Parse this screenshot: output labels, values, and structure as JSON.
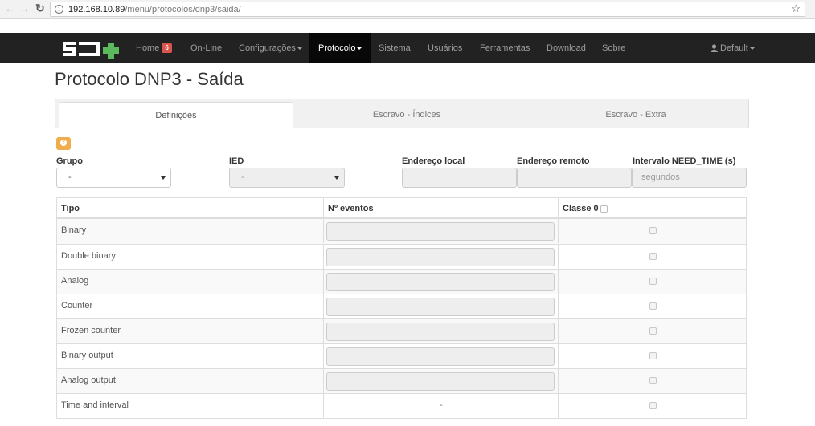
{
  "browser": {
    "url_host": "192.168.10.89",
    "url_path": "/menu/protocolos/dnp3/saida/"
  },
  "navbar": {
    "home_label": "Home",
    "home_badge": "6",
    "items": [
      {
        "label": "On-Line"
      },
      {
        "label": "Configurações"
      },
      {
        "label": "Protocolo"
      },
      {
        "label": "Sistema"
      },
      {
        "label": "Usuários"
      },
      {
        "label": "Ferramentas"
      },
      {
        "label": "Download"
      },
      {
        "label": "Sobre"
      }
    ],
    "active_item": "Protocolo",
    "user_label": "Default"
  },
  "page": {
    "title": "Protocolo DNP3 - Saída"
  },
  "tabs": [
    {
      "label": "Definições",
      "active": true
    },
    {
      "label": "Escravo - Índices",
      "active": false
    },
    {
      "label": "Escravo - Extra",
      "active": false
    }
  ],
  "form": {
    "grupo": {
      "label": "Grupo",
      "value": "-"
    },
    "ied": {
      "label": "IED",
      "value": "-"
    },
    "endereco_local": {
      "label": "Endereço local",
      "value": ""
    },
    "endereco_remoto": {
      "label": "Endereço remoto",
      "value": ""
    },
    "intervalo": {
      "label": "Intervalo NEED_TIME (s)",
      "placeholder": "segundos"
    }
  },
  "table": {
    "headers": [
      "Tipo",
      "Nº eventos",
      "Classe 0"
    ],
    "rows": [
      {
        "tipo": "Binary",
        "eventos": "",
        "classe0": false
      },
      {
        "tipo": "Double binary",
        "eventos": "",
        "classe0": false
      },
      {
        "tipo": "Analog",
        "eventos": "",
        "classe0": false
      },
      {
        "tipo": "Counter",
        "eventos": "",
        "classe0": false
      },
      {
        "tipo": "Frozen counter",
        "eventos": "",
        "classe0": false
      },
      {
        "tipo": "Binary output",
        "eventos": "",
        "classe0": false
      },
      {
        "tipo": "Analog output",
        "eventos": "",
        "classe0": false
      },
      {
        "tipo": "Time and interval",
        "eventos": "-",
        "classe0": false
      }
    ]
  },
  "colors": {
    "navbar_bg": "#222222",
    "navbar_active": "#080808",
    "badge": "#d9534f",
    "help_button": "#f0ad4e",
    "logo_green": "#5cb85c"
  }
}
